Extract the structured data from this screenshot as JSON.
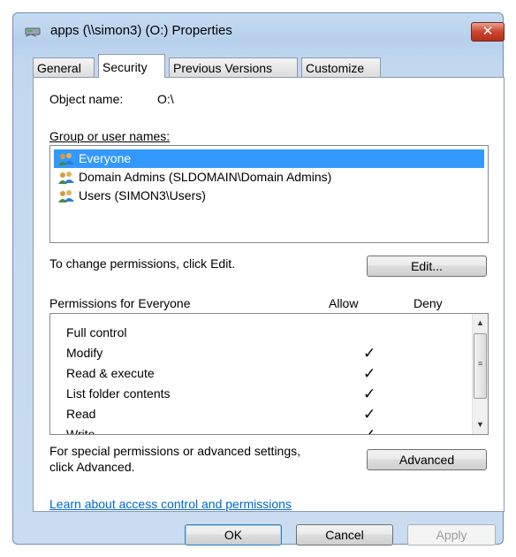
{
  "window": {
    "title": "apps (\\\\simon3) (O:) Properties",
    "close_label": "✕"
  },
  "tabs": [
    {
      "label": "General"
    },
    {
      "label": "Security"
    },
    {
      "label": "Previous Versions"
    },
    {
      "label": "Customize"
    }
  ],
  "security": {
    "object_name_label": "Object name:",
    "object_name_value": "O:\\",
    "group_label": "Group or user names:",
    "users": [
      {
        "label": "Everyone",
        "selected": true,
        "icon": "users-icon"
      },
      {
        "label": "Domain Admins (SLDOMAIN\\Domain Admins)",
        "selected": false,
        "icon": "users-icon"
      },
      {
        "label": "Users (SIMON3\\Users)",
        "selected": false,
        "icon": "users-icon"
      }
    ],
    "change_text": "To change permissions, click Edit.",
    "edit_label": "Edit...",
    "permissions_label": "Permissions for Everyone",
    "allow_header": "Allow",
    "deny_header": "Deny",
    "permissions": [
      {
        "name": "Full control",
        "allow": false,
        "deny": false
      },
      {
        "name": "Modify",
        "allow": true,
        "deny": false
      },
      {
        "name": "Read & execute",
        "allow": true,
        "deny": false
      },
      {
        "name": "List folder contents",
        "allow": true,
        "deny": false
      },
      {
        "name": "Read",
        "allow": true,
        "deny": false
      },
      {
        "name": "Write",
        "allow": true,
        "deny": false
      }
    ],
    "check_glyph": "✓",
    "special_text_1": "For special permissions or advanced settings,",
    "special_text_2": "click Advanced.",
    "advanced_label": "Advanced",
    "learn_link": "Learn about access control and permissions"
  },
  "footer": {
    "ok_label": "OK",
    "cancel_label": "Cancel",
    "apply_label": "Apply"
  },
  "colors": {
    "selection": "#3399ff",
    "link": "#0066cc",
    "close_button": "#c9462f"
  }
}
